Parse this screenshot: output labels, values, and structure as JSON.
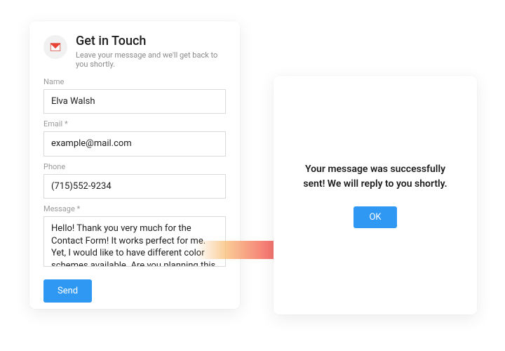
{
  "form": {
    "title": "Get in Touch",
    "subtitle": "Leave your message and we'll get back to you shortly.",
    "fields": {
      "name": {
        "label": "Name",
        "value": "Elva Walsh"
      },
      "email": {
        "label": "Email *",
        "value": "example@mail.com"
      },
      "phone": {
        "label": "Phone",
        "value": "(715)552-9234"
      },
      "message": {
        "label": "Message *",
        "value": "Hello! Thank you very much for the Contact Form! It works perfect for me. Yet, I would like to have different color schemes available. Are you planning this update?"
      }
    },
    "send_label": "Send"
  },
  "confirm": {
    "text": "Your message was successfully sent! We will reply to you shortly.",
    "ok_label": "OK"
  }
}
